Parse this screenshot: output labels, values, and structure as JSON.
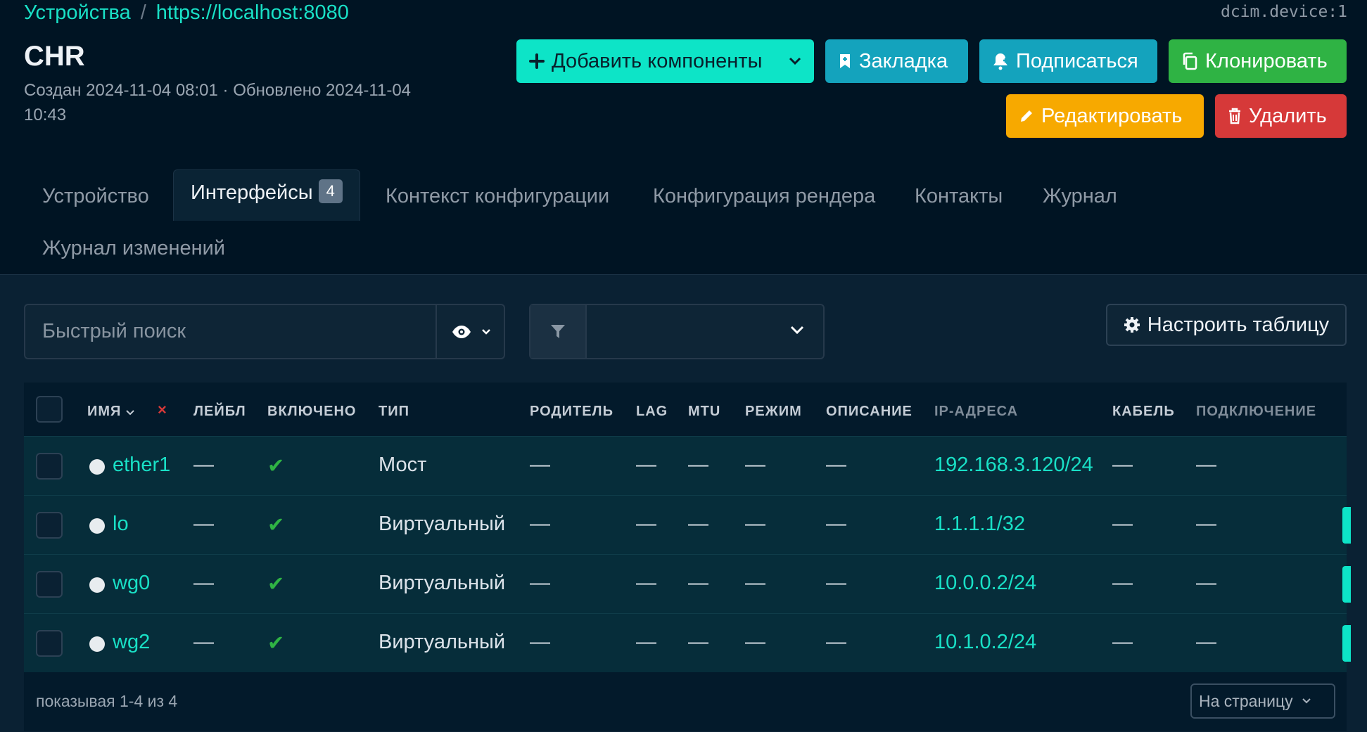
{
  "breadcrumb": {
    "parent": "Устройства",
    "separator": "/",
    "current": "https://localhost:8080"
  },
  "object_ref": "dcim.device:1",
  "device": {
    "title": "CHR",
    "meta": "Создан 2024-11-04 08:01 · Обновлено 2024-11-04 10:43"
  },
  "actions": {
    "add_components": "Добавить компоненты",
    "bookmark": "Закладка",
    "subscribe": "Подписаться",
    "clone": "Клонировать",
    "edit": "Редактировать",
    "delete": "Удалить"
  },
  "tabs": {
    "device": "Устройство",
    "interfaces": "Интерфейсы",
    "interfaces_count": "4",
    "config_context": "Контекст конфигурации",
    "render_config": "Конфигурация рендера",
    "contacts": "Контакты",
    "journal": "Журнал",
    "changelog": "Журнал изменений"
  },
  "search": {
    "placeholder": "Быстрый поиск"
  },
  "configure_table": "Настроить таблицу",
  "columns": {
    "name": "ИМЯ",
    "clear": "×",
    "label": "ЛЕЙБЛ",
    "enabled": "ВКЛЮЧЕНО",
    "type": "ТИП",
    "parent": "РОДИТЕЛЬ",
    "lag": "LAG",
    "mtu": "MTU",
    "mode": "РЕЖИМ",
    "description": "ОПИСАНИЕ",
    "ip_addresses": "IP-АДРЕСА",
    "cable": "КАБЕЛЬ",
    "connection": "ПОДКЛЮЧЕНИЕ"
  },
  "rows": [
    {
      "name": "ether1",
      "label": "—",
      "enabled": "✔",
      "type": "Мост",
      "parent": "—",
      "lag": "—",
      "mtu": "—",
      "mode": "—",
      "description": "—",
      "ip": "192.168.3.120/24",
      "cable": "—",
      "connection": "—"
    },
    {
      "name": "lo",
      "label": "—",
      "enabled": "✔",
      "type": "Виртуальный",
      "parent": "—",
      "lag": "—",
      "mtu": "—",
      "mode": "—",
      "description": "—",
      "ip": "1.1.1.1/32",
      "cable": "—",
      "connection": "—"
    },
    {
      "name": "wg0",
      "label": "—",
      "enabled": "✔",
      "type": "Виртуальный",
      "parent": "—",
      "lag": "—",
      "mtu": "—",
      "mode": "—",
      "description": "—",
      "ip": "10.0.0.2/24",
      "cable": "—",
      "connection": "—"
    },
    {
      "name": "wg2",
      "label": "—",
      "enabled": "✔",
      "type": "Виртуальный",
      "parent": "—",
      "lag": "—",
      "mtu": "—",
      "mode": "—",
      "description": "—",
      "ip": "10.1.0.2/24",
      "cable": "—",
      "connection": "—"
    }
  ],
  "footer": {
    "info": "показывая 1-4 из 4",
    "per_page": "На страницу"
  }
}
